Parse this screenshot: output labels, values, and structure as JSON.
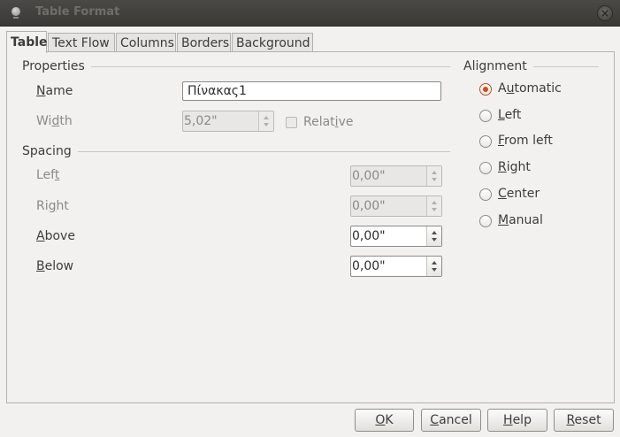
{
  "window": {
    "title": "Table Format"
  },
  "tabs": [
    {
      "label": "Table",
      "active": true
    },
    {
      "label": "Text Flow",
      "active": false
    },
    {
      "label": "Columns",
      "active": false
    },
    {
      "label": "Borders",
      "active": false
    },
    {
      "label": "Background",
      "active": false
    }
  ],
  "properties": {
    "title": "Properties",
    "name_label_first": "N",
    "name_label_rest": "ame",
    "name_value": "Πίνακας1",
    "width_label_first": "Wi",
    "width_label_u": "d",
    "width_label_rest": "th",
    "width_value": "5,02\"",
    "relative_label_first": "Relat",
    "relative_label_u": "i",
    "relative_label_rest": "ve"
  },
  "spacing": {
    "title": "Spacing",
    "left_label_first": "Lef",
    "left_label_u": "t",
    "left_value": "0,00\"",
    "right_label_first": "Ri",
    "right_label_u": "g",
    "right_label_rest": "ht",
    "right_value": "0,00\"",
    "above_label_u": "A",
    "above_label_rest": "bove",
    "above_value": "0,00\"",
    "below_label_u": "B",
    "below_label_rest": "elow",
    "below_value": "0,00\""
  },
  "alignment": {
    "title": "Alignment",
    "options": [
      {
        "label_first": "A",
        "label_u": "u",
        "label_rest": "tomatic",
        "checked": true
      },
      {
        "label_first": "",
        "label_u": "L",
        "label_rest": "eft",
        "checked": false
      },
      {
        "label_first": "",
        "label_u": "F",
        "label_rest": "rom left",
        "checked": false
      },
      {
        "label_first": "",
        "label_u": "R",
        "label_rest": "ight",
        "checked": false
      },
      {
        "label_first": "",
        "label_u": "C",
        "label_rest": "enter",
        "checked": false
      },
      {
        "label_first": "",
        "label_u": "M",
        "label_rest": "anual",
        "checked": false
      }
    ]
  },
  "buttons": {
    "ok_u": "O",
    "ok_rest": "K",
    "cancel_u": "C",
    "cancel_rest": "ancel",
    "help_u": "H",
    "help_rest": "elp",
    "reset_u": "R",
    "reset_rest": "eset"
  },
  "colors": {
    "accent": "#dd4814",
    "titlebar": "#3c3b37",
    "background": "#f2f1f0"
  },
  "icons": {
    "window_icon": "window-menu-icon",
    "close": "close-icon"
  }
}
